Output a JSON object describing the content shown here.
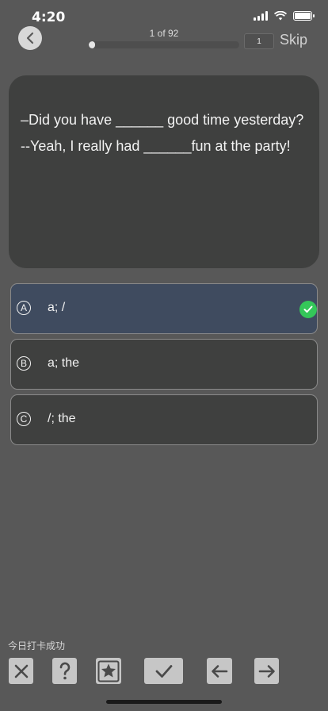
{
  "status_bar": {
    "time": "4:20"
  },
  "header": {
    "progress_label": "1 of 92",
    "progress_fraction": 0.043,
    "page_number": "1",
    "skip_label": "Skip"
  },
  "question": {
    "lines": [
      "–Did you have ______ good time yesterday?",
      "--Yeah, I really had ______fun at the party!"
    ]
  },
  "options": [
    {
      "letter": "A",
      "text": "a; /",
      "selected": true
    },
    {
      "letter": "B",
      "text": "a; the",
      "selected": false
    },
    {
      "letter": "C",
      "text": "/; the",
      "selected": false
    }
  ],
  "footer": {
    "checkin_text": "今日打卡成功",
    "tools": [
      "close-icon",
      "question-mark-icon",
      "star-icon",
      "checkmark-icon",
      "arrow-left-icon",
      "arrow-right-icon"
    ]
  },
  "colors": {
    "background": "#585858",
    "card": "#3f403f",
    "selected_option": "#3f4b5f",
    "correct_badge": "#34c759",
    "tool_button": "#c6c6c6"
  }
}
